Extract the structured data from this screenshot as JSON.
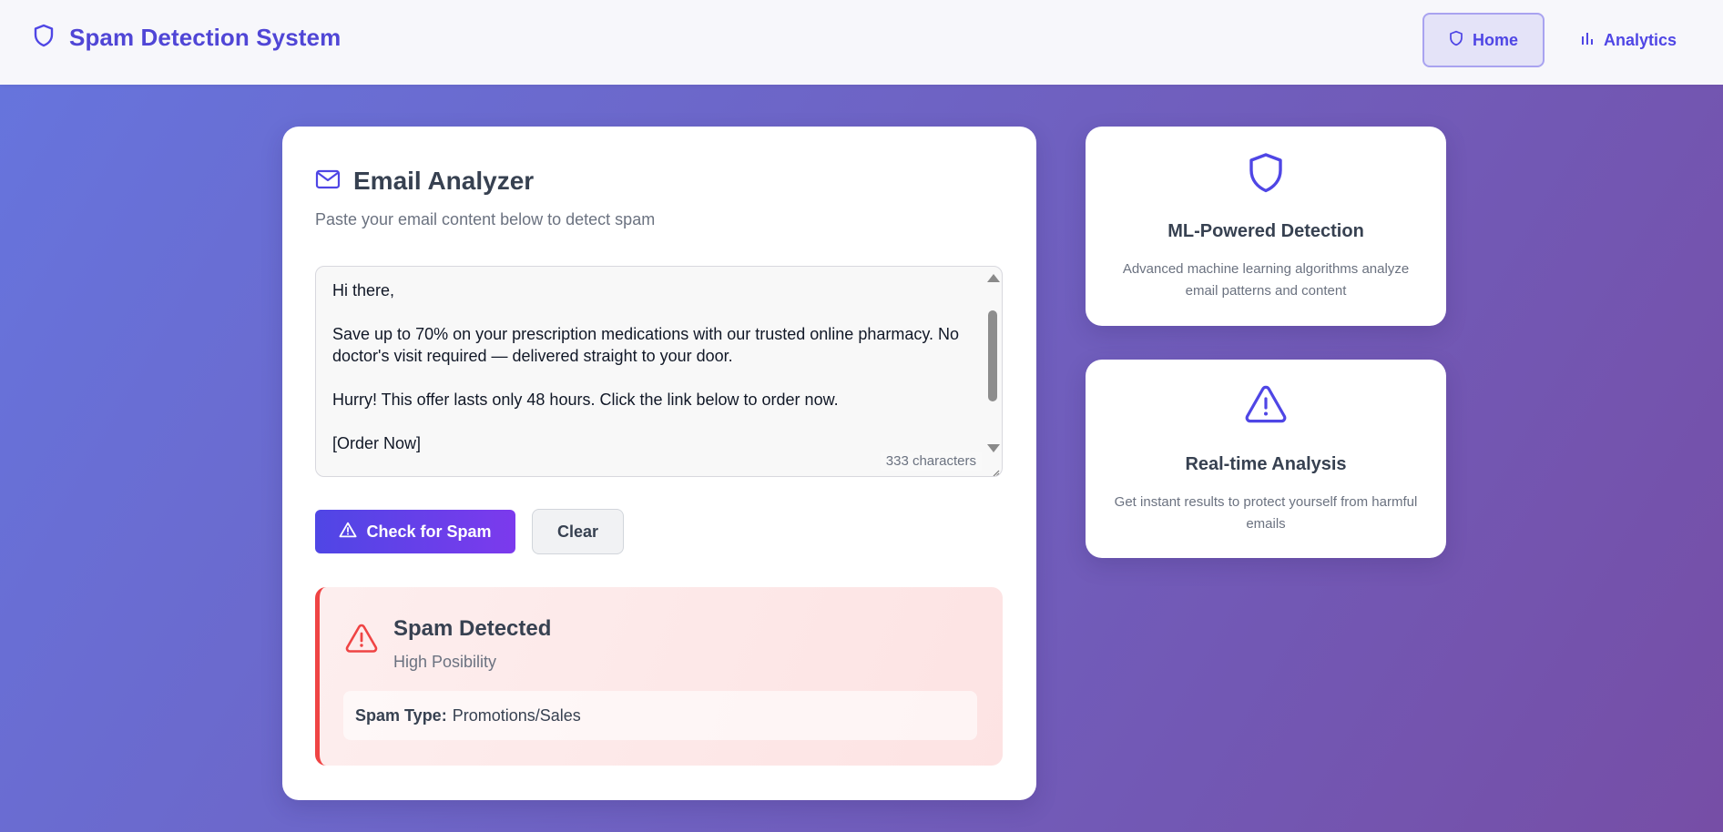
{
  "header": {
    "app_title": "Spam Detection System",
    "nav": [
      {
        "label": "Home",
        "icon": "shield-icon",
        "active": true
      },
      {
        "label": "Analytics",
        "icon": "bar-chart-icon",
        "active": false
      }
    ]
  },
  "analyzer": {
    "title": "Email Analyzer",
    "subtitle": "Paste your email content below to detect spam",
    "email_text": "Hi there,\n\nSave up to 70% on your prescription medications with our trusted online pharmacy. No doctor's visit required — delivered straight to your door.\n\nHurry! This offer lasts only 48 hours. Click the link below to order now.\n\n[Order Now]",
    "char_count": "333 characters",
    "check_button": "Check for Spam",
    "clear_button": "Clear"
  },
  "result": {
    "title": "Spam Detected",
    "subtitle": "High Posibility",
    "type_label": "Spam Type:",
    "type_value": "Promotions/Sales",
    "accent_color": "#ef4444"
  },
  "features": [
    {
      "icon": "shield-icon",
      "title": "ML-Powered Detection",
      "description": "Advanced machine learning algorithms analyze email patterns and content"
    },
    {
      "icon": "warning-icon",
      "title": "Real-time Analysis",
      "description": "Get instant results to protect yourself from harmful emails"
    }
  ],
  "colors": {
    "brand": "#4f46e5",
    "background_start": "#6675de",
    "background_end": "#764ea6",
    "danger": "#ef4444"
  }
}
